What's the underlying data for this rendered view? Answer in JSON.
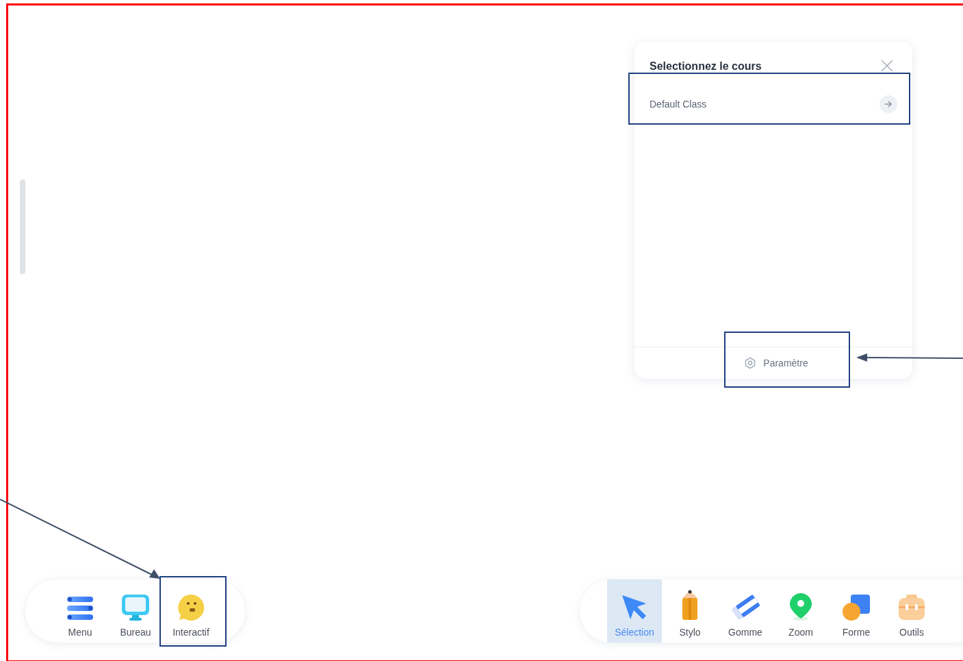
{
  "course_panel": {
    "title": "Selectionnez le cours",
    "courses": [
      {
        "name": "Default Class"
      }
    ],
    "settings_label": "Paramètre"
  },
  "left_toolbar": [
    {
      "label": "Menu",
      "kind": "menu",
      "selected": false
    },
    {
      "label": "Bureau",
      "kind": "desktop",
      "selected": false
    },
    {
      "label": "Interactif",
      "kind": "face",
      "selected": false
    }
  ],
  "right_toolbar": [
    {
      "label": "Sélection",
      "kind": "cursor",
      "selected": true
    },
    {
      "label": "Stylo",
      "kind": "pencil",
      "selected": false
    },
    {
      "label": "Gomme",
      "kind": "eraser",
      "selected": false
    },
    {
      "label": "Zoom",
      "kind": "pin",
      "selected": false
    },
    {
      "label": "Forme",
      "kind": "shape",
      "selected": false
    },
    {
      "label": "Outils",
      "kind": "toolbox",
      "selected": false
    }
  ]
}
